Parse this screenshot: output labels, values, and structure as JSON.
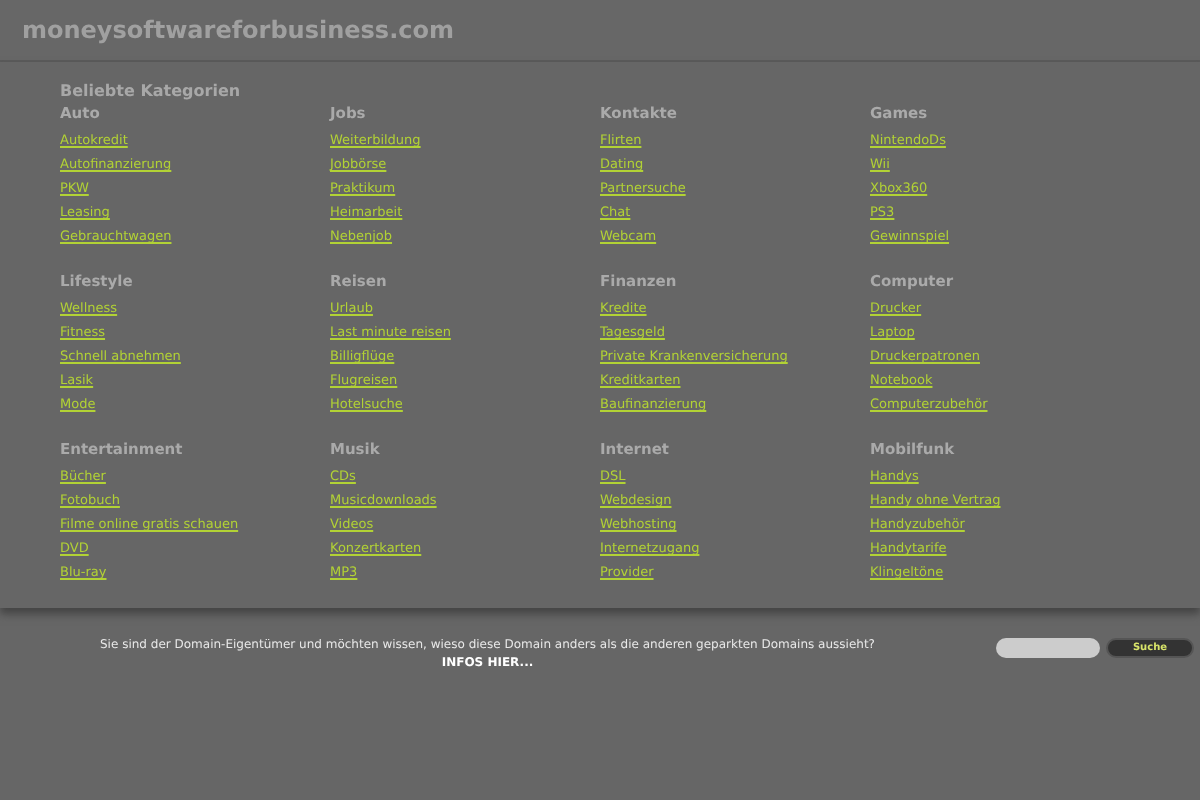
{
  "site_title": "moneysoftwareforbusiness.com",
  "section_title": "Beliebte Kategorien",
  "categories": [
    {
      "title": "Auto",
      "links": [
        "Autokredit",
        "Autofinanzierung",
        "PKW",
        "Leasing",
        "Gebrauchtwagen"
      ]
    },
    {
      "title": "Jobs",
      "links": [
        "Weiterbildung",
        "Jobbörse",
        "Praktikum",
        "Heimarbeit",
        "Nebenjob"
      ]
    },
    {
      "title": "Kontakte",
      "links": [
        "Flirten",
        "Dating",
        "Partnersuche",
        "Chat",
        "Webcam"
      ]
    },
    {
      "title": "Games",
      "links": [
        "NintendoDs",
        "Wii",
        "Xbox360",
        "PS3",
        "Gewinnspiel"
      ]
    },
    {
      "title": "Lifestyle",
      "links": [
        "Wellness",
        "Fitness",
        "Schnell abnehmen",
        "Lasik",
        "Mode"
      ]
    },
    {
      "title": "Reisen",
      "links": [
        "Urlaub",
        "Last minute reisen",
        "Billigflüge",
        "Flugreisen",
        "Hotelsuche"
      ]
    },
    {
      "title": "Finanzen",
      "links": [
        "Kredite",
        "Tagesgeld",
        "Private Krankenversicherung",
        "Kreditkarten",
        "Baufinanzierung"
      ]
    },
    {
      "title": "Computer",
      "links": [
        "Drucker",
        "Laptop",
        "Druckerpatronen",
        "Notebook",
        "Computerzubehör"
      ]
    },
    {
      "title": "Entertainment",
      "links": [
        "Bücher",
        "Fotobuch",
        "Filme online gratis schauen",
        "DVD",
        "Blu-ray"
      ]
    },
    {
      "title": "Musik",
      "links": [
        "CDs",
        "Musicdownloads",
        "Videos",
        "Konzertkarten",
        "MP3"
      ]
    },
    {
      "title": "Internet",
      "links": [
        "DSL",
        "Webdesign",
        "Webhosting",
        "Internetzugang",
        "Provider"
      ]
    },
    {
      "title": "Mobilfunk",
      "links": [
        "Handys",
        "Handy ohne Vertrag",
        "Handyzubehör",
        "Handytarife",
        "Klingeltöne"
      ]
    }
  ],
  "footer": {
    "question": "Sie sind der Domain-Eigentümer und möchten wissen, wieso diese Domain anders als die anderen geparkten Domains aussieht?",
    "info_link": "INFOS HIER..."
  },
  "search": {
    "button": "Suche"
  }
}
